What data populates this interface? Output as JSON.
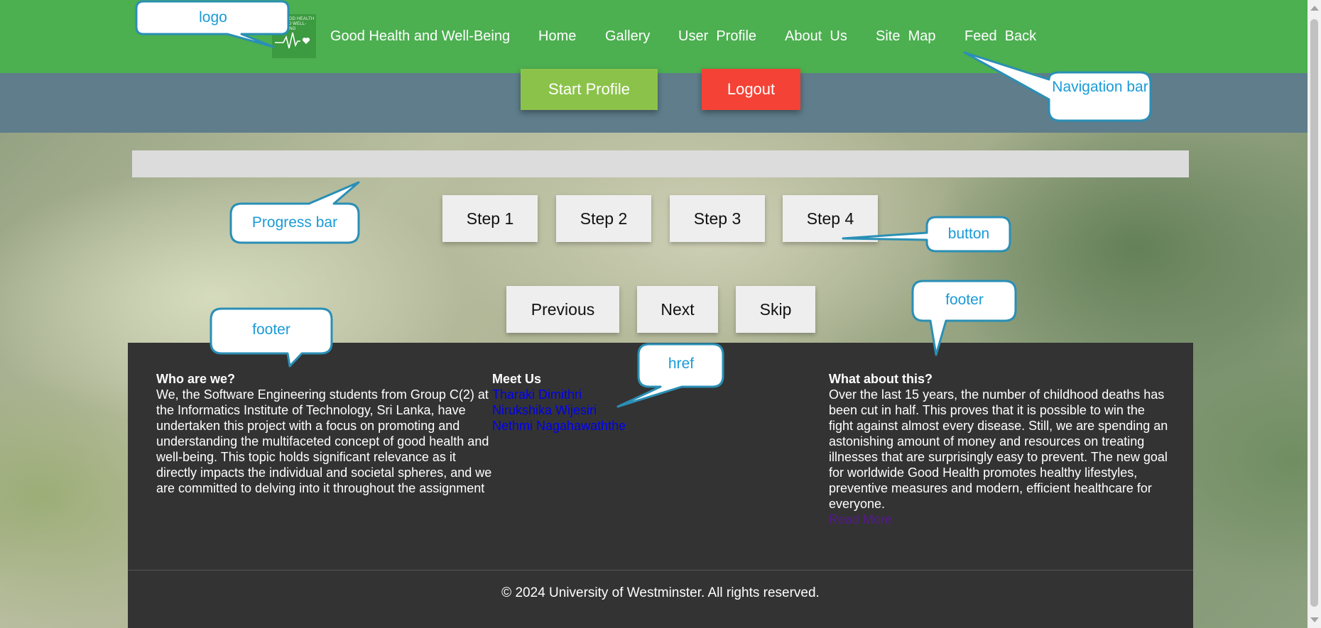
{
  "nav": {
    "logo_text": "GOOD HEALTH AND WELL-BEING",
    "brand": "Good Health and Well-Being",
    "links": [
      "Home",
      "Gallery",
      "User  Profile",
      "About  Us",
      "Site  Map",
      "Feed  Back"
    ]
  },
  "actions": {
    "start": "Start Profile",
    "logout": "Logout"
  },
  "progress": {
    "value_percent": 0
  },
  "steps": [
    "Step 1",
    "Step 2",
    "Step 3",
    "Step 4"
  ],
  "controls": {
    "previous": "Previous",
    "next": "Next",
    "skip": "Skip"
  },
  "footer": {
    "who": {
      "title": "Who are we?",
      "text": "We, the Software Engineering students from Group C(2) at the Informatics Institute of Technology, Sri Lanka, have undertaken this project with a focus on promoting and understanding the multifaceted concept of good health and well-being. This topic holds significant relevance as it directly impacts the individual and societal spheres, and we are committed to delving into it throughout the assignment"
    },
    "meet": {
      "title": "Meet Us",
      "members": [
        "Tharaki Dimithri",
        "Nirukshika Wijesiri",
        "Nethmi Nagahawaththe"
      ]
    },
    "about": {
      "title": "What about this?",
      "text": "Over the last 15 years, the number of childhood deaths has been cut in half. This proves that it is possible to win the fight against almost every disease. Still, we are spending an astonishing amount of money and resources on treating illnesses that are surprisingly easy to prevent. The new goal for worldwide Good Health promotes healthy lifestyles, preventive measures and modern, efficient healthcare for everyone.",
      "read_more": "Read More"
    },
    "copyright": "© 2024 University of Westminster. All rights reserved."
  },
  "annotations": {
    "logo": "logo",
    "navigation": "Navigation bar",
    "progress": "Progress bar",
    "button": "button",
    "footer_left": "footer",
    "footer_right": "footer",
    "href": "href"
  },
  "colors": {
    "nav": "#4caf50",
    "band": "#5f7d8b",
    "start": "#8bc34a",
    "logout": "#f44336",
    "footer": "#333333",
    "callout_text": "#1a9bd7",
    "callout_border": "#2a8fb5"
  }
}
